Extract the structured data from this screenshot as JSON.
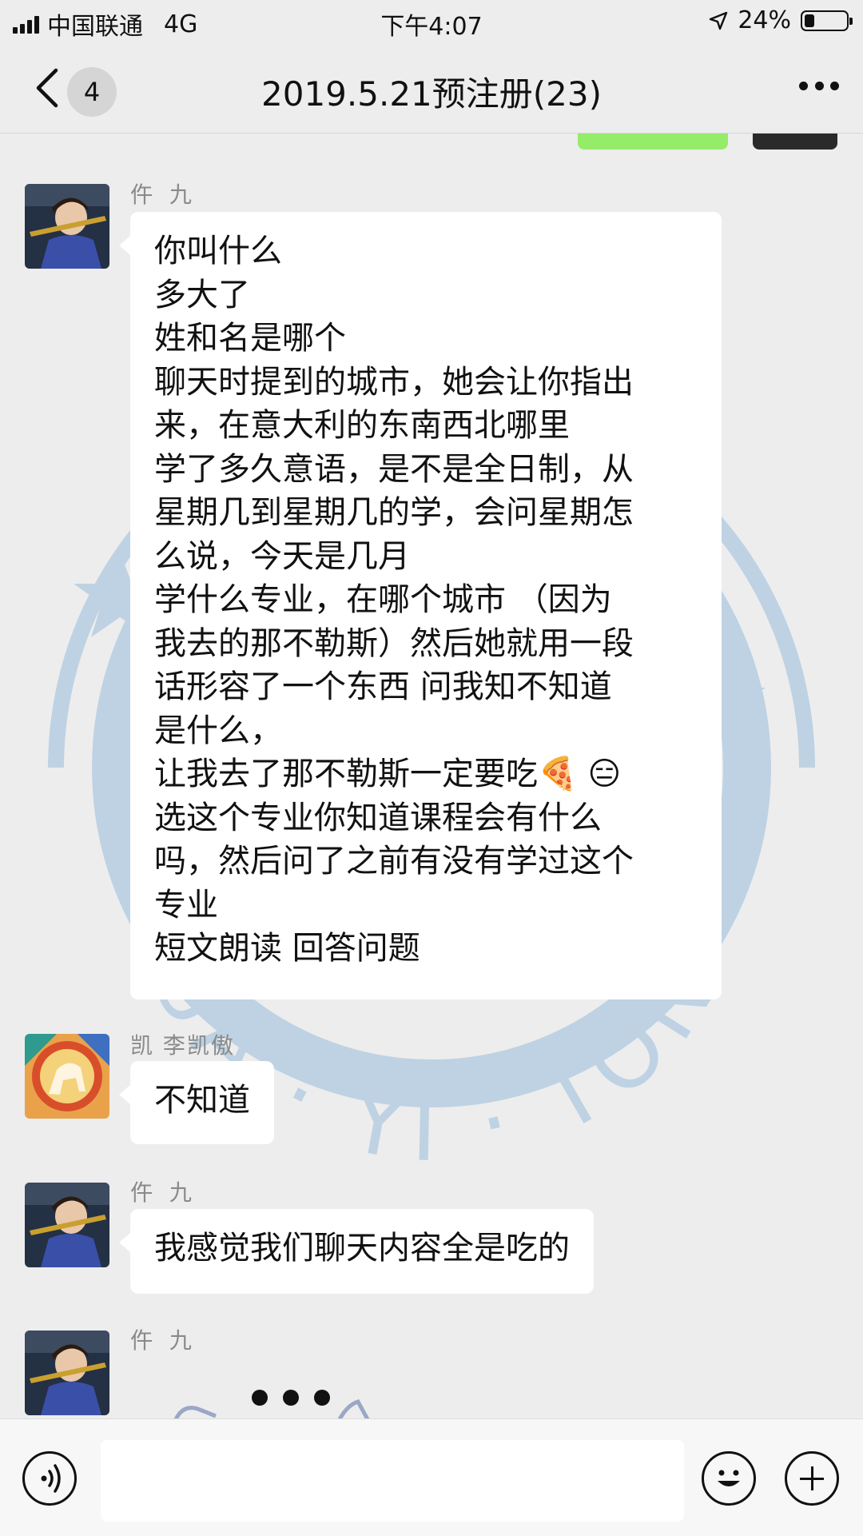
{
  "status_bar": {
    "carrier": "中国联通",
    "network": "4G",
    "time": "下午4:07",
    "battery": "24%",
    "battery_level": 0.24,
    "icons": [
      "signal-icon",
      "location-arrow-icon",
      "battery-icon"
    ]
  },
  "nav": {
    "back_icon": "chevron-left-icon",
    "unread_count": "4",
    "title": "2019.5.21预注册(23)",
    "more_icon": "more-dots-icon"
  },
  "watermark": {
    "text": "HUA · YI · TONG"
  },
  "messages": [
    {
      "sender": "仵 九",
      "lines": [
        "你叫什么",
        "多大了",
        "姓和名是哪个",
        "聊天时提到的城市，她会让你指出",
        "来，在意大利的东南西北哪里",
        "学了多久意语，是不是全日制，从",
        "星期几到星期几的学，会问星期怎",
        "么说，今天是几月",
        "学什么专业，在哪个城市 （因为",
        "我去的那不勒斯）然后她就用一段",
        "话形容了一个东西 问我知不知道",
        "是什么，",
        "让我去了那不勒斯一定要吃🍕 😑",
        "选这个专业你知道课程会有什么",
        "吗，然后问了之前有没有学过这个",
        "专业",
        "短文朗读 回答问题"
      ]
    },
    {
      "sender": "凯 李凯傲",
      "lines": [
        "不知道"
      ]
    },
    {
      "sender": "仵 九",
      "lines": [
        "我感觉我们聊天内容全是吃的"
      ]
    },
    {
      "sender": "仵 九",
      "lines": []
    }
  ],
  "input_bar": {
    "voice_icon": "voice-icon",
    "emoji_icon": "emoji-icon",
    "plus_icon": "plus-icon",
    "text": ""
  },
  "colors": {
    "background": "#ededed",
    "bubble": "#ffffff",
    "own_bubble": "#95ec69",
    "watermark": "#5f9ccf"
  }
}
